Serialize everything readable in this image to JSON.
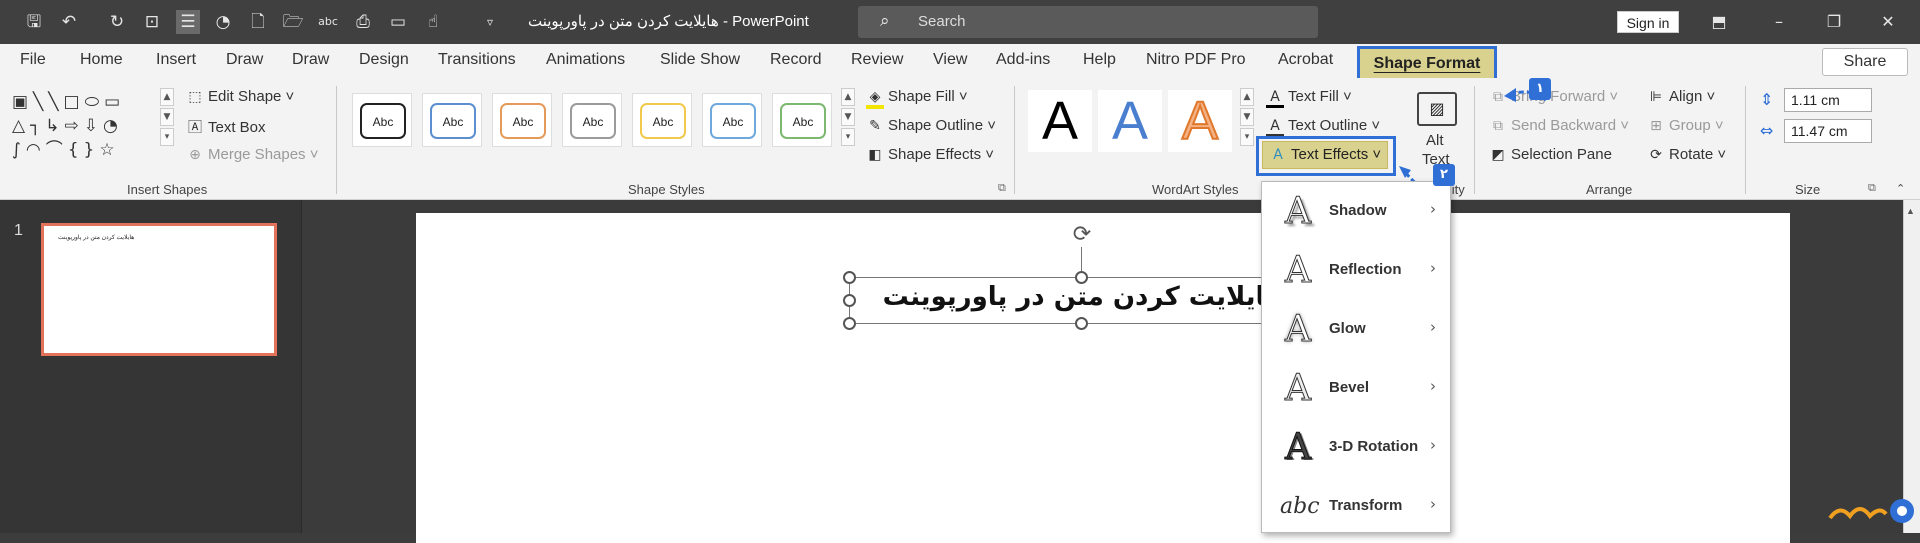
{
  "app": {
    "name": "PowerPoint",
    "doc_title": "هایلایت کردن متن در پاورپوینت  -  PowerPoint"
  },
  "titlebar": {
    "search_placeholder": "Search",
    "sign_in": "Sign in",
    "icons": [
      "save-icon",
      "undo-icon",
      "redo-icon",
      "present-icon",
      "view-icon",
      "theme-icon",
      "new-file-icon",
      "open-folder-icon",
      "spelling-icon",
      "print-preview-icon",
      "image-icon",
      "touch-mode-icon",
      "customize-icon"
    ]
  },
  "tabs": [
    "File",
    "Home",
    "Insert",
    "Draw",
    "Draw",
    "Design",
    "Transitions",
    "Animations",
    "Slide Show",
    "Record",
    "Review",
    "View",
    "Add-ins",
    "Help",
    "Nitro PDF Pro",
    "Acrobat",
    "Shape Format"
  ],
  "share": "Share",
  "ribbon": {
    "insert_shapes": {
      "label": "Insert Shapes",
      "edit_shape": "Edit Shape",
      "text_box": "Text Box",
      "merge_shapes": "Merge Shapes"
    },
    "shape_styles": {
      "label": "Shape Styles",
      "swatch_text": "Abc",
      "swatch_colors": [
        "#222222",
        "#5b8fd0",
        "#e59a5a",
        "#9b9b9b",
        "#f2c94c",
        "#6fa8dc",
        "#7cb86f"
      ],
      "shape_fill": "Shape Fill",
      "shape_outline": "Shape Outline",
      "shape_effects": "Shape Effects"
    },
    "wordart": {
      "label": "WordArt Styles",
      "sample": "A",
      "text_fill": "Text Fill",
      "text_outline": "Text Outline",
      "text_effects": "Text Effects"
    },
    "accessibility": {
      "alt_text_line1": "Alt",
      "alt_text_line2": "Text",
      "label_fragment": "ility"
    },
    "arrange": {
      "label": "Arrange",
      "bring_forward": "Bring Forward",
      "send_backward": "Send Backward",
      "selection_pane": "Selection Pane",
      "align": "Align",
      "group": "Group",
      "rotate": "Rotate"
    },
    "size": {
      "label": "Size",
      "height": "1.11 cm",
      "width": "11.47 cm"
    }
  },
  "annotations": {
    "badge1": "۱",
    "badge2": "۲"
  },
  "slides": {
    "number": "1",
    "thumb_text": "هایلایت کردن متن در پاورپوینت",
    "slide_text": "هایلایت کردن متن در پاورپوینت"
  },
  "dropdown": [
    {
      "label": "Shadow",
      "icon": "A"
    },
    {
      "label": "Reflection",
      "icon": "A"
    },
    {
      "label": "Glow",
      "icon": "A"
    },
    {
      "label": "Bevel",
      "icon": "A"
    },
    {
      "label": "3-D Rotation",
      "icon": "A"
    },
    {
      "label": "Transform",
      "icon": "abc"
    }
  ],
  "colors": {
    "accent_blue": "#2f6fd6",
    "highlight_yellow": "#d9d28f",
    "thumb_border": "#e2735a"
  }
}
